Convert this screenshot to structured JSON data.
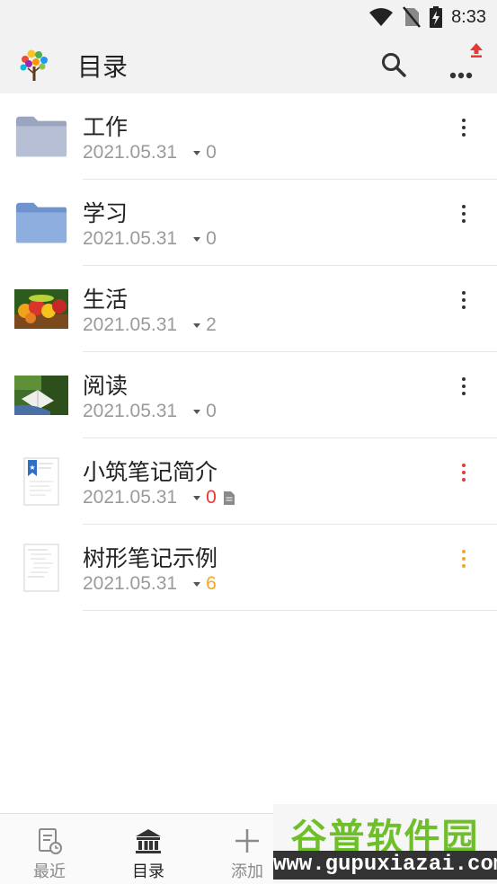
{
  "status_bar": {
    "time": "8:33"
  },
  "app_bar": {
    "title": "目录"
  },
  "items": [
    {
      "title": "工作",
      "date": "2021.05.31",
      "count": "0",
      "count_color": "#9a9a9a",
      "menu_color": "#333333",
      "icon": "folder-gray-icon"
    },
    {
      "title": "学习",
      "date": "2021.05.31",
      "count": "0",
      "count_color": "#9a9a9a",
      "menu_color": "#333333",
      "icon": "folder-blue-icon"
    },
    {
      "title": "生活",
      "date": "2021.05.31",
      "count": "2",
      "count_color": "#9a9a9a",
      "menu_color": "#333333",
      "icon": "fruit-basket-photo"
    },
    {
      "title": "阅读",
      "date": "2021.05.31",
      "count": "0",
      "count_color": "#9a9a9a",
      "menu_color": "#333333",
      "icon": "reading-photo"
    },
    {
      "title": "小筑笔记简介",
      "date": "2021.05.31",
      "count": "0",
      "count_color": "#e53935",
      "menu_color": "#e53935",
      "icon": "note-doc-icon"
    },
    {
      "title": "树形笔记示例",
      "date": "2021.05.31",
      "count": "6",
      "count_color": "#f5a623",
      "menu_color": "#f5a623",
      "icon": "tree-doc-icon"
    }
  ],
  "bottom_nav": [
    {
      "label": "最近",
      "icon": "recent-icon",
      "active": false
    },
    {
      "label": "目录",
      "icon": "library-icon",
      "active": true
    },
    {
      "label": "添加",
      "icon": "add-icon",
      "active": false
    }
  ],
  "watermark": {
    "top": "谷普软件园",
    "bottom": "www.gupuxiazai.com"
  },
  "colors": {
    "accent": "#e53935",
    "orange": "#f5a623",
    "gray_text": "#9a9a9a",
    "nav_inactive": "#8a8a8a",
    "nav_active": "#222222"
  }
}
